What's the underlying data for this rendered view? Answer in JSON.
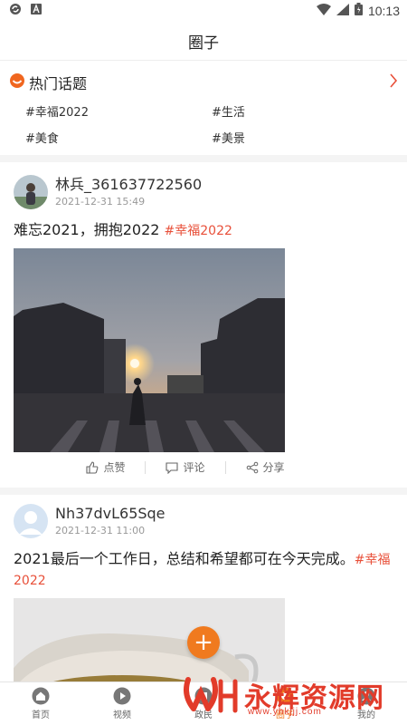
{
  "status_bar": {
    "time": "10:13"
  },
  "header": {
    "title": "圈子"
  },
  "hot_topics": {
    "title": "热门话题",
    "items": [
      "#幸福2022",
      "#生活",
      "#美食",
      "#美景"
    ]
  },
  "posts": [
    {
      "username": "林兵_361637722560",
      "time": "2021-12-31 15:49",
      "text": "难忘2021，拥抱2022 ",
      "tag": "#幸福2022",
      "actions": {
        "like": "点赞",
        "comment": "评论",
        "share": "分享"
      }
    },
    {
      "username": "Nh37dvL65Sqe",
      "time": "2021-12-31 11:00",
      "text": "2021最后一个工作日，总结和希望都可在今天完成。",
      "tag": "#幸福2022"
    }
  ],
  "fab": {
    "label": "+"
  },
  "tabbar": {
    "items": [
      {
        "label": "首页"
      },
      {
        "label": "视频"
      },
      {
        "label": "政民"
      },
      {
        "label": "圈子"
      },
      {
        "label": "我的"
      }
    ]
  },
  "watermark": {
    "text": "永辉资源网",
    "url": "www.yhkjjj.com"
  },
  "colors": {
    "accent": "#f07a1f",
    "tag": "#e8503a"
  }
}
